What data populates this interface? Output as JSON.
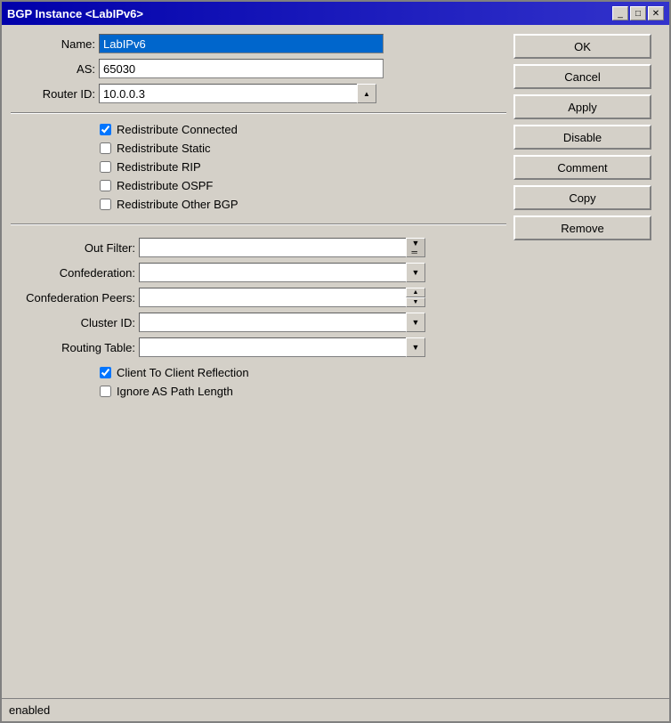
{
  "window": {
    "title": "BGP Instance <LabIPv6>",
    "min_btn": "_",
    "max_btn": "□",
    "close_btn": "✕"
  },
  "form": {
    "name_label": "Name:",
    "name_value": "LabIPv6",
    "as_label": "AS:",
    "as_value": "65030",
    "router_id_label": "Router ID:",
    "router_id_value": "10.0.0.3",
    "checkboxes": [
      {
        "id": "cb1",
        "label": "Redistribute Connected",
        "checked": true
      },
      {
        "id": "cb2",
        "label": "Redistribute Static",
        "checked": false
      },
      {
        "id": "cb3",
        "label": "Redistribute RIP",
        "checked": false
      },
      {
        "id": "cb4",
        "label": "Redistribute OSPF",
        "checked": false
      },
      {
        "id": "cb5",
        "label": "Redistribute Other BGP",
        "checked": false
      }
    ],
    "out_filter_label": "Out Filter:",
    "out_filter_value": "",
    "confederation_label": "Confederation:",
    "confederation_value": "",
    "conf_peers_label": "Confederation Peers:",
    "conf_peers_value": "",
    "cluster_id_label": "Cluster ID:",
    "cluster_id_value": "",
    "routing_table_label": "Routing Table:",
    "routing_table_value": "",
    "bottom_checkboxes": [
      {
        "id": "cb6",
        "label": "Client To Client Reflection",
        "checked": true
      },
      {
        "id": "cb7",
        "label": "Ignore AS Path Length",
        "checked": false
      }
    ]
  },
  "buttons": {
    "ok_label": "OK",
    "cancel_label": "Cancel",
    "apply_label": "Apply",
    "disable_label": "Disable",
    "comment_label": "Comment",
    "copy_label": "Copy",
    "remove_label": "Remove"
  },
  "status": {
    "text": "enabled"
  }
}
